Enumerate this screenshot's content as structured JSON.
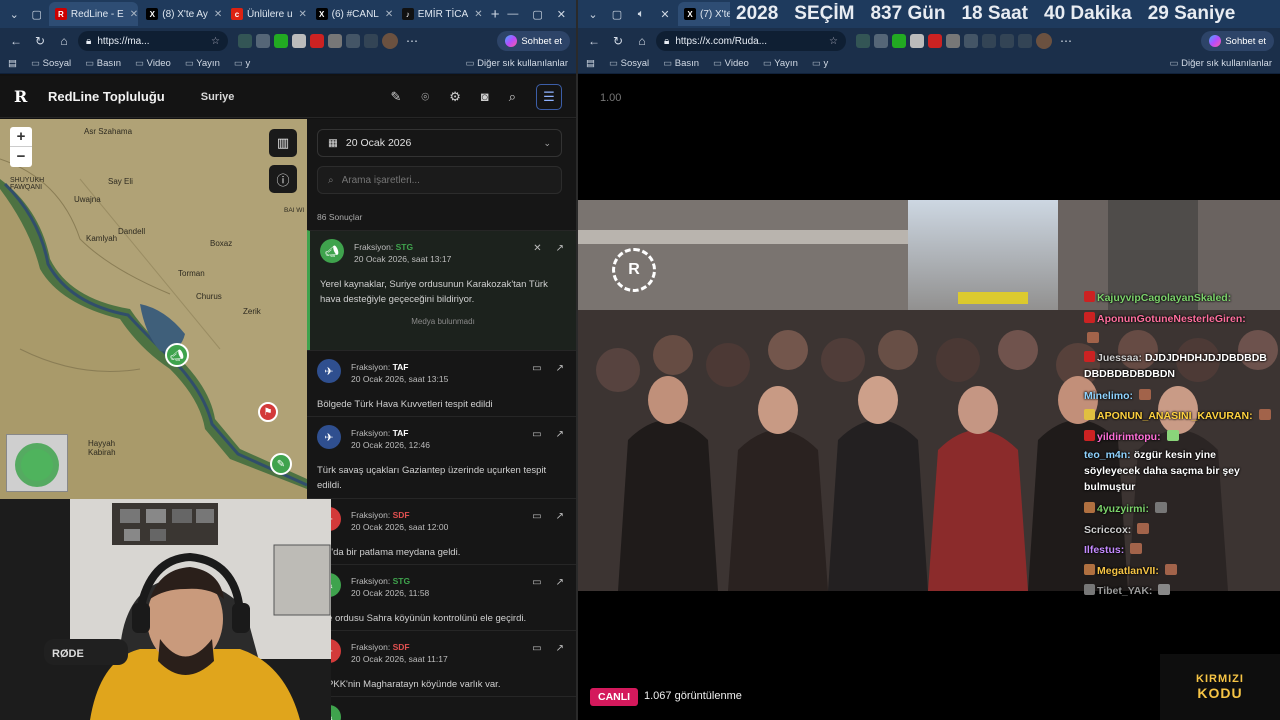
{
  "left_browser": {
    "tabs": [
      {
        "label": "RedLine - E",
        "icon": "redline-favicon",
        "active": true
      },
      {
        "label": "(8) X'te Ay",
        "icon": "x-favicon"
      },
      {
        "label": "Ünlülere u",
        "icon": "news-favicon"
      },
      {
        "label": "(6) #CANL",
        "icon": "x-favicon"
      },
      {
        "label": "EMİR TİCA",
        "icon": "tiktok-favicon"
      }
    ],
    "url": "https://ma...",
    "copilot_label": "Sohbet et",
    "bookmarks": [
      "Sosyal",
      "Basın",
      "Video",
      "Yayın",
      "y"
    ],
    "other_bookmarks": "Diğer sık kullanılanlar"
  },
  "right_browser": {
    "tabs": [
      {
        "label": "(7) X'te",
        "icon": "x-favicon"
      }
    ],
    "countdown": [
      "2028",
      "SEÇİM",
      "837 Gün",
      "18 Saat",
      "40 Dakika",
      "29 Saniye"
    ],
    "url": "https://x.com/Ruda...",
    "copilot_label": "Sohbet et",
    "bookmarks": [
      "Sosyal",
      "Basın",
      "Video",
      "Yayın",
      "y"
    ],
    "other_bookmarks": "Diğer sık kullanılanlar"
  },
  "app": {
    "logo": "R",
    "title": "RedLine Topluluğu",
    "region": "Suriye",
    "date": "20 Ocak 2026",
    "search_placeholder": "Arama işaretleri...",
    "results": "86 Sonuçlar",
    "faction_label": "Fraksiyon:",
    "no_media": "Medya bulunmadı"
  },
  "map": {
    "places": [
      {
        "name": "Asr Szahama"
      },
      {
        "name": "SHUYUKH FAWQANI"
      },
      {
        "name": "Say Eli"
      },
      {
        "name": "Uwajna"
      },
      {
        "name": "Dandell"
      },
      {
        "name": "Boxaz"
      },
      {
        "name": "Kamlyah"
      },
      {
        "name": "Torman"
      },
      {
        "name": "Churus"
      },
      {
        "name": "Zerik"
      },
      {
        "name": "Hayyah Kabirah"
      },
      {
        "name": "BAI WI"
      }
    ]
  },
  "feed": [
    {
      "faction": "STG",
      "faction_color": "#3fa34d",
      "time": "20 Ocak 2026, saat 13:17",
      "text": "Yerel kaynaklar, Suriye ordusunun Karakozak'tan Türk hava desteğiyle geçeceğini bildiriyor.",
      "selected": true
    },
    {
      "faction": "TAF",
      "faction_color": "#2f4f8f",
      "time": "20 Ocak 2026, saat 13:15",
      "text": "Bölgede Türk Hava Kuvvetleri tespit edildi"
    },
    {
      "faction": "TAF",
      "faction_color": "#2f4f8f",
      "time": "20 Ocak 2026, 12:46",
      "text": "Türk savaş uçakları Gaziantep üzerinde uçurken tespit edildi."
    },
    {
      "faction": "SDF",
      "faction_color": "#d33a3a",
      "time": "20 Ocak 2026, saat 12:00",
      "text": "Hol'da bir patlama meydana geldi."
    },
    {
      "faction": "STG",
      "faction_color": "#3fa34d",
      "time": "20 Ocak 2026, 11:58",
      "text": "riye ordusu Sahra köyünün kontrolünü ele geçirdi."
    },
    {
      "faction": "SDF",
      "faction_color": "#d33a3a",
      "time": "20 Ocak 2026, saat 11:17",
      "text": "G/PKK'nin Magharatayn köyünde varlık var."
    }
  ],
  "stream": {
    "speed": "1.00",
    "live_label": "CANLI",
    "views": "1.067 görüntülenme",
    "brand_line1": "KIRMIZI",
    "brand_line2": "KODU",
    "chat": [
      {
        "user": "KajuyvipCagolayanSkaled:",
        "color": "#7cd36b",
        "msg": ""
      },
      {
        "user": "AponunGotuneNesterleGiren:",
        "color": "#ff6f9e",
        "msg": ""
      },
      {
        "user": "Juessaa:",
        "color": "#cfcfcf",
        "msg": "DJDJDHDHJDJDBDBDBDBDBDBDBDBDN"
      },
      {
        "user": "Minelimo:",
        "color": "#8fd3ff",
        "msg": ""
      },
      {
        "user": "APONUN_ANASINI_KAVURAN:",
        "color": "#ffd23f",
        "msg": ""
      },
      {
        "user": "yildirimtopu:",
        "color": "#ff6fd8",
        "msg": ""
      },
      {
        "user": "teo_m4n:",
        "color": "#8fd3ff",
        "msg": "özgür kesin yine söyleyecek daha saçma bir şey bulmuştur"
      },
      {
        "user": "4yuzyirmi:",
        "color": "#7cd36b",
        "msg": ""
      },
      {
        "user": "Scriccox:",
        "color": "#cfcfcf",
        "msg": ""
      },
      {
        "user": "Ilfestus:",
        "color": "#c48bff",
        "msg": ""
      },
      {
        "user": "MegatlanVII:",
        "color": "#f6c445",
        "msg": ""
      },
      {
        "user": "Tibet_YAK:",
        "color": "#9a9a9a",
        "msg": ""
      }
    ]
  }
}
